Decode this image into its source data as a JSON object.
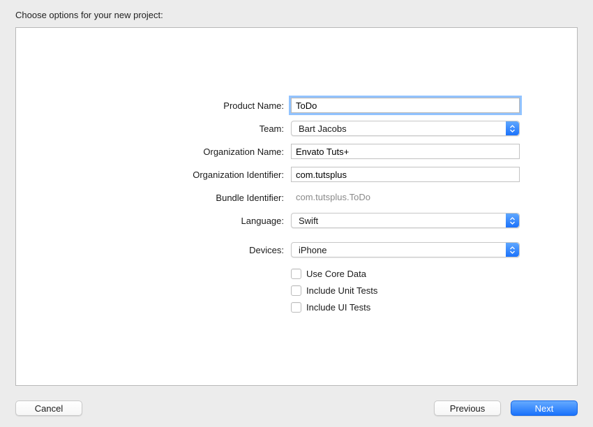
{
  "dialog": {
    "title": "Choose options for your new project:"
  },
  "form": {
    "productName": {
      "label": "Product Name:",
      "value": "ToDo"
    },
    "team": {
      "label": "Team:",
      "value": "Bart Jacobs"
    },
    "orgName": {
      "label": "Organization Name:",
      "value": "Envato Tuts+"
    },
    "orgIdentifier": {
      "label": "Organization Identifier:",
      "value": "com.tutsplus"
    },
    "bundleIdentifier": {
      "label": "Bundle Identifier:",
      "value": "com.tutsplus.ToDo"
    },
    "language": {
      "label": "Language:",
      "value": "Swift"
    },
    "devices": {
      "label": "Devices:",
      "value": "iPhone"
    },
    "checkboxes": {
      "coreData": {
        "label": "Use Core Data",
        "checked": false
      },
      "unitTests": {
        "label": "Include Unit Tests",
        "checked": false
      },
      "uiTests": {
        "label": "Include UI Tests",
        "checked": false
      }
    }
  },
  "footer": {
    "cancel": "Cancel",
    "previous": "Previous",
    "next": "Next"
  }
}
